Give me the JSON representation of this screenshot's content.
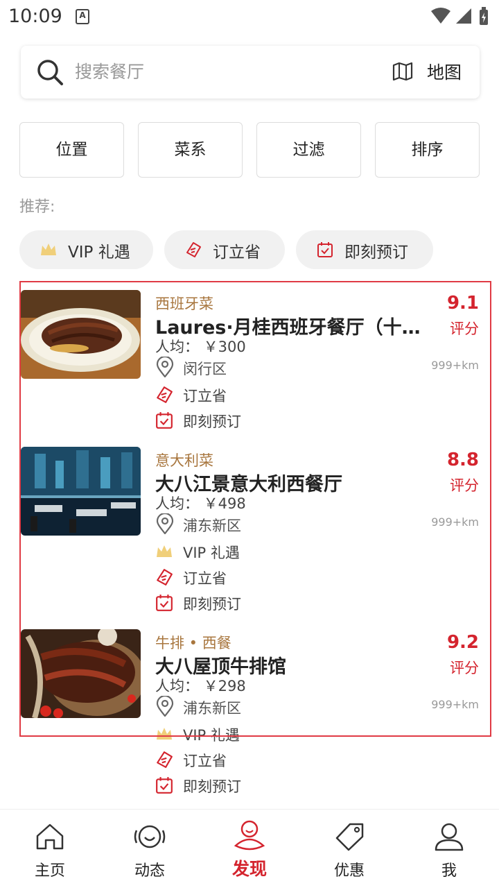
{
  "status": {
    "time": "10:09",
    "a_icon": "A"
  },
  "search": {
    "placeholder": "搜索餐厅",
    "map_label": "地图"
  },
  "filters": [
    {
      "label": "位置"
    },
    {
      "label": "菜系"
    },
    {
      "label": "过滤"
    },
    {
      "label": "排序"
    }
  ],
  "recommend_label": "推荐:",
  "chips": [
    {
      "label": "VIP 礼遇",
      "icon": "crown-icon"
    },
    {
      "label": "订立省",
      "icon": "tag-icon"
    },
    {
      "label": "即刻预订",
      "icon": "calendar-icon"
    }
  ],
  "restaurants": [
    {
      "category": "西班牙菜",
      "name": "Laures·月桂西班牙餐厅（十...",
      "price": "人均：  ￥300",
      "district": "闵行区",
      "distance": "999+km",
      "score": "9.1",
      "score_label": "评分",
      "perks": [
        "订立省",
        "即刻预订"
      ]
    },
    {
      "category": "意大利菜",
      "name": "大八江景意大利西餐厅",
      "price": "人均：  ￥498",
      "district": "浦东新区",
      "distance": "999+km",
      "score": "8.8",
      "score_label": "评分",
      "perks": [
        "VIP 礼遇",
        "订立省",
        "即刻预订"
      ]
    },
    {
      "category": "牛排 • 西餐",
      "name": "大八屋顶牛排馆",
      "price": "人均：  ￥298",
      "district": "浦东新区",
      "distance": "999+km",
      "score": "9.2",
      "score_label": "评分",
      "perks": [
        "VIP 礼遇",
        "订立省",
        "即刻预订"
      ]
    }
  ],
  "tabs": [
    {
      "label": "主页",
      "icon": "home-icon"
    },
    {
      "label": "动态",
      "icon": "chat-icon"
    },
    {
      "label": "发现",
      "icon": "discover-icon",
      "active": true
    },
    {
      "label": "优惠",
      "icon": "coupon-icon"
    },
    {
      "label": "我",
      "icon": "profile-icon"
    }
  ],
  "colors": {
    "accent": "#d4242e",
    "category": "#a8763e",
    "highlight_border": "#e03a44"
  }
}
